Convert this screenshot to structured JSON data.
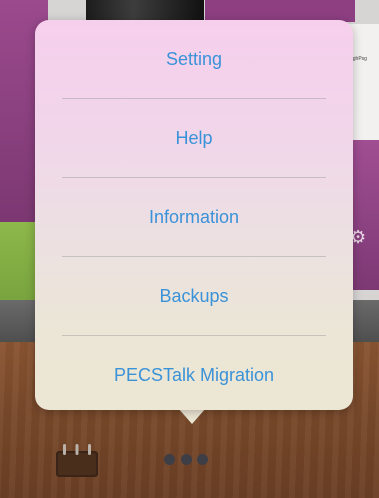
{
  "background": {
    "tile_snippet_text": "ughPsg",
    "gear_icon": "gear-icon"
  },
  "menu": {
    "items": [
      {
        "label": "Setting"
      },
      {
        "label": "Help"
      },
      {
        "label": "Information"
      },
      {
        "label": "Backups"
      },
      {
        "label": "PECSTalk Migration"
      }
    ]
  },
  "toolbar": {
    "binder_icon": "binder-icon",
    "more_icon": "more-icon"
  },
  "colors": {
    "menu_text": "#3a92d8",
    "popover_top": "#f6cfec",
    "popover_bottom": "#ece6d4",
    "accent_purple": "#8d3f82",
    "accent_green": "#8db84a",
    "wood": "#7a4a2b"
  }
}
